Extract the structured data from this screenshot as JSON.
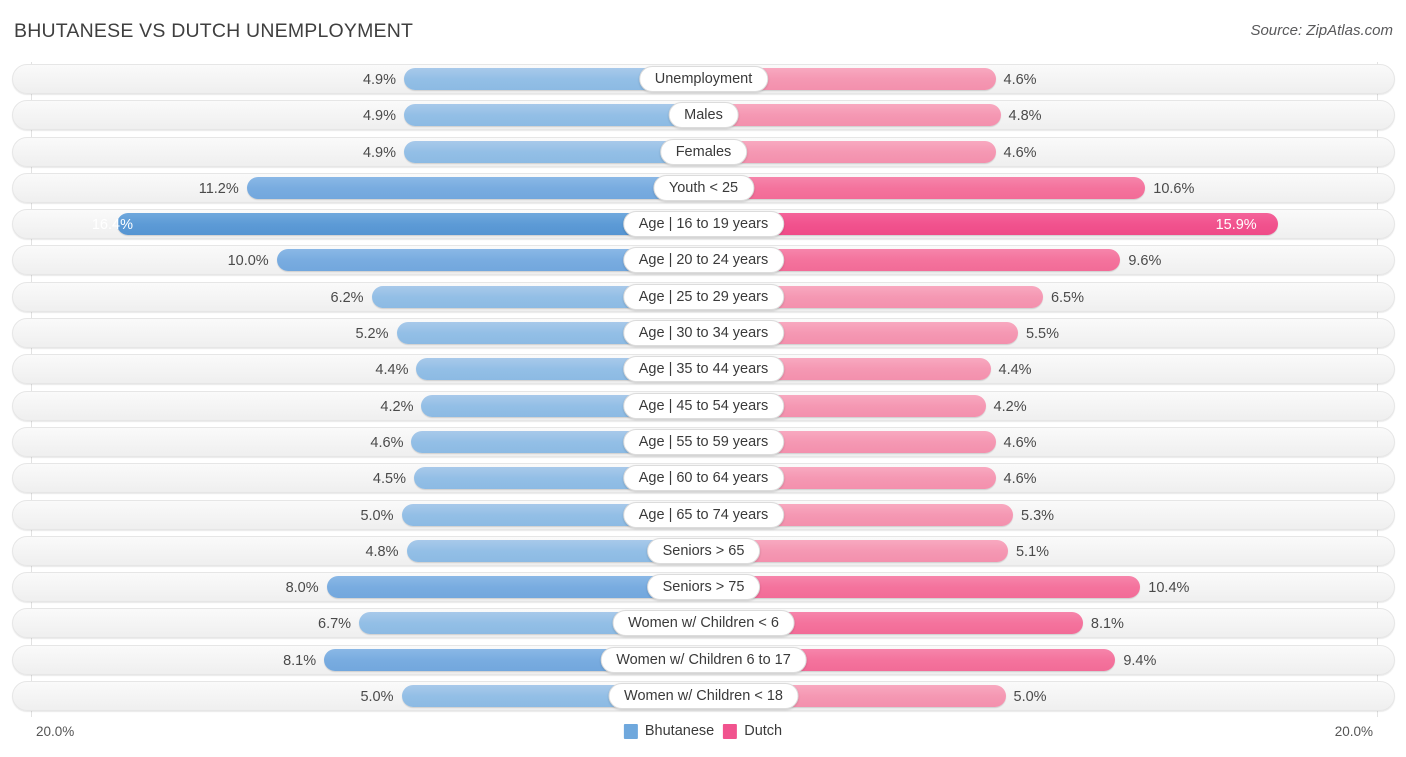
{
  "header": {
    "title": "BHUTANESE VS DUTCH UNEMPLOYMENT",
    "source": "Source: ZipAtlas.com"
  },
  "footer": {
    "axis_left": "20.0%",
    "axis_right": "20.0%",
    "legend": [
      {
        "label": "Bhutanese",
        "color": "#6fa8dd"
      },
      {
        "label": "Dutch",
        "color": "#f1538e"
      }
    ]
  },
  "chart_data": {
    "type": "bar",
    "title": "BHUTANESE VS DUTCH UNEMPLOYMENT",
    "subtitle": "Source: ZipAtlas.com",
    "orientation": "horizontal-diverging",
    "xlabel": "",
    "ylabel": "",
    "xlim": [
      20.0,
      20.0
    ],
    "axis_left_label": "20.0%",
    "axis_right_label": "20.0%",
    "grid": true,
    "legend_position": "bottom-center",
    "categories": [
      "Unemployment",
      "Males",
      "Females",
      "Youth < 25",
      "Age | 16 to 19 years",
      "Age | 20 to 24 years",
      "Age | 25 to 29 years",
      "Age | 30 to 34 years",
      "Age | 35 to 44 years",
      "Age | 45 to 54 years",
      "Age | 55 to 59 years",
      "Age | 60 to 64 years",
      "Age | 65 to 74 years",
      "Seniors > 65",
      "Seniors > 75",
      "Women w/ Children < 6",
      "Women w/ Children 6 to 17",
      "Women w/ Children < 18"
    ],
    "series": [
      {
        "name": "Bhutanese",
        "color": "#6fa8dd",
        "values": [
          4.9,
          4.9,
          4.9,
          11.2,
          16.4,
          10.0,
          6.2,
          5.2,
          4.4,
          4.2,
          4.6,
          4.5,
          5.0,
          4.8,
          8.0,
          6.7,
          8.1,
          5.0
        ],
        "labels": [
          "4.9%",
          "4.9%",
          "4.9%",
          "11.2%",
          "16.4%",
          "10.0%",
          "6.2%",
          "5.2%",
          "4.4%",
          "4.2%",
          "4.6%",
          "4.5%",
          "5.0%",
          "4.8%",
          "8.0%",
          "6.7%",
          "8.1%",
          "5.0%"
        ]
      },
      {
        "name": "Dutch",
        "color": "#f1538e",
        "values": [
          4.6,
          4.8,
          4.6,
          10.6,
          15.9,
          9.6,
          6.5,
          5.5,
          4.4,
          4.2,
          4.6,
          4.6,
          5.3,
          5.1,
          10.4,
          8.1,
          9.4,
          5.0
        ],
        "labels": [
          "4.6%",
          "4.8%",
          "4.6%",
          "10.6%",
          "15.9%",
          "9.6%",
          "6.5%",
          "5.5%",
          "4.4%",
          "4.2%",
          "4.6%",
          "4.6%",
          "5.3%",
          "5.1%",
          "10.4%",
          "8.1%",
          "9.4%",
          "5.0%"
        ]
      }
    ]
  }
}
